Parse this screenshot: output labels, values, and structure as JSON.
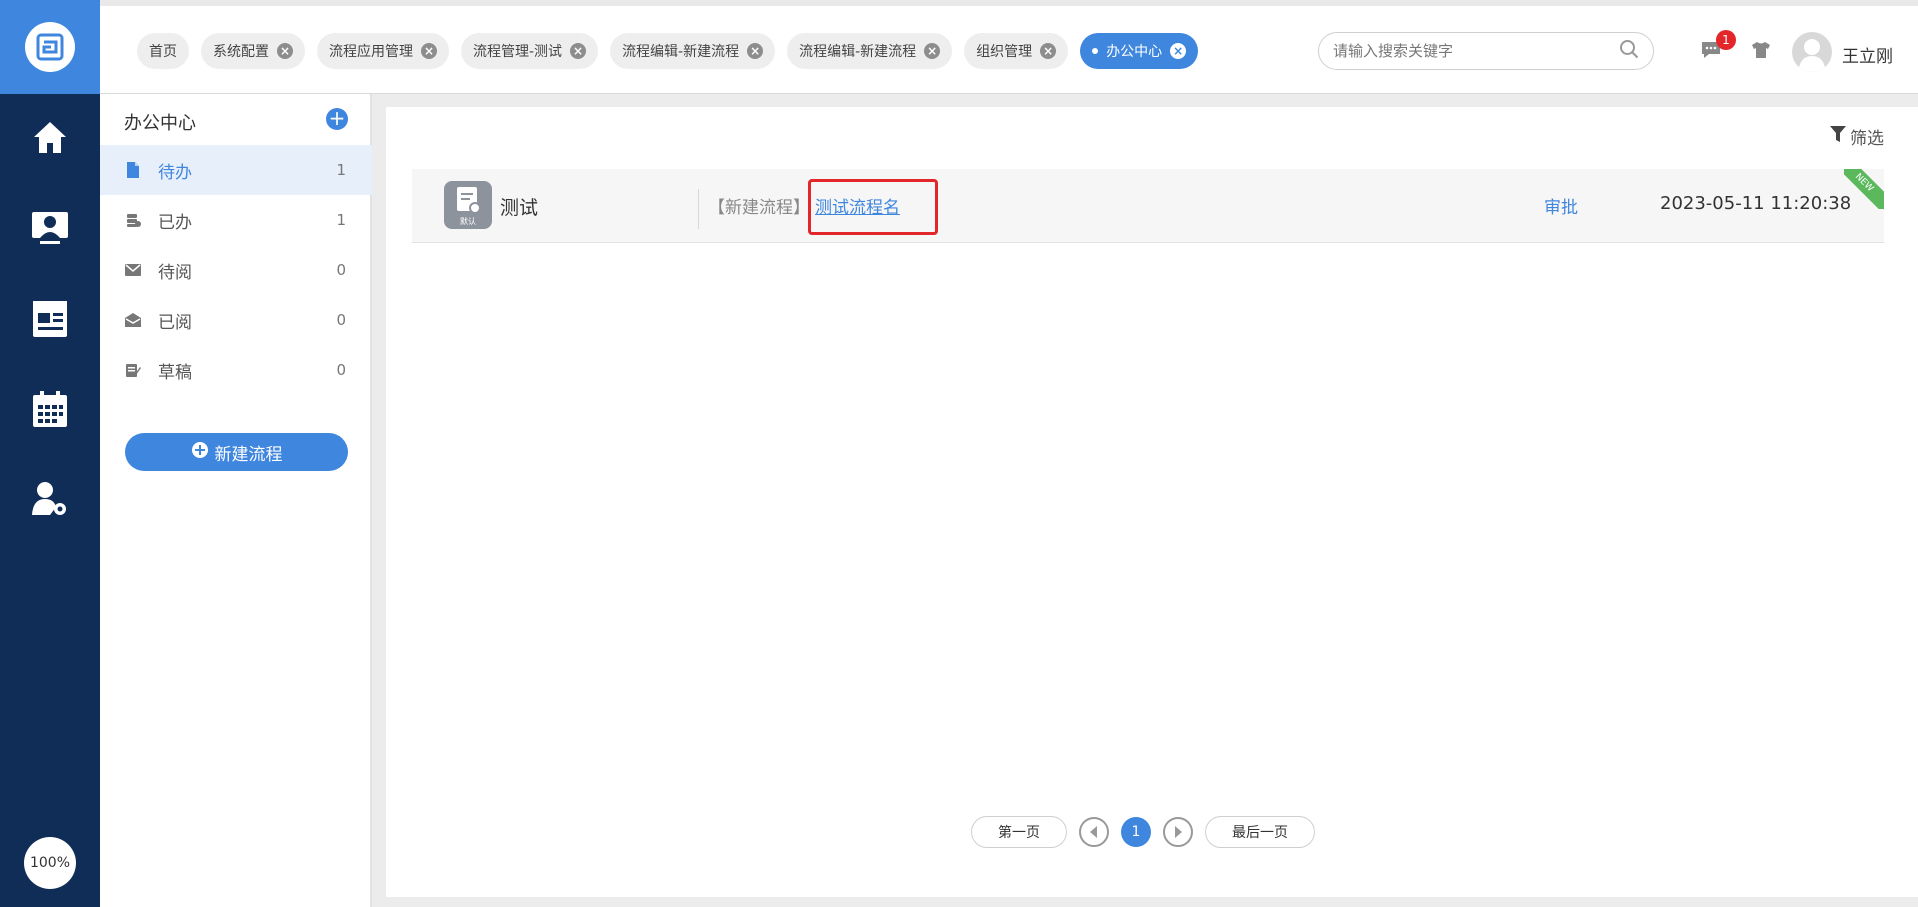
{
  "tabs": [
    {
      "label": "首页",
      "closable": false,
      "active": false
    },
    {
      "label": "系统配置",
      "closable": true,
      "active": false
    },
    {
      "label": "流程应用管理",
      "closable": true,
      "active": false
    },
    {
      "label": "流程管理-测试",
      "closable": true,
      "active": false
    },
    {
      "label": "流程编辑-新建流程",
      "closable": true,
      "active": false
    },
    {
      "label": "流程编辑-新建流程",
      "closable": true,
      "active": false
    },
    {
      "label": "组织管理",
      "closable": true,
      "active": false
    },
    {
      "label": "办公中心",
      "closable": true,
      "active": true
    }
  ],
  "search": {
    "placeholder": "请输入搜索关键字"
  },
  "header": {
    "notification_count": "1",
    "username": "王立刚"
  },
  "rail": {
    "zoom": "100%"
  },
  "sidebar": {
    "title": "办公中心",
    "items": [
      {
        "label": "待办",
        "count": "1",
        "active": true
      },
      {
        "label": "已办",
        "count": "1",
        "active": false
      },
      {
        "label": "待阅",
        "count": "0",
        "active": false
      },
      {
        "label": "已阅",
        "count": "0",
        "active": false
      },
      {
        "label": "草稿",
        "count": "0",
        "active": false
      }
    ],
    "new_flow_label": "新建流程"
  },
  "main": {
    "filter_label": "筛选",
    "rows": [
      {
        "app_name": "测试",
        "app_icon_caption": "默认",
        "type": "【新建流程】",
        "title": "测试流程名",
        "action": "审批",
        "time": "2023-05-11 11:20:38",
        "ribbon": "NEW"
      }
    ],
    "pager": {
      "first": "第一页",
      "current": "1",
      "last": "最后一页"
    }
  },
  "colors": {
    "accent": "#3f86de",
    "rail": "#0f2d56",
    "badge": "#e3262a",
    "ribbon": "#5cb85c"
  }
}
